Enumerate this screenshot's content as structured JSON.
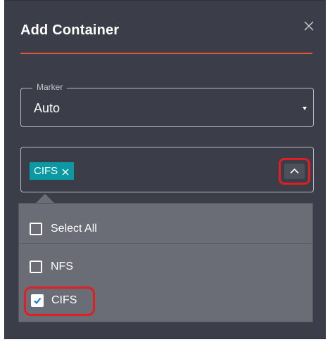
{
  "dialog": {
    "title": "Add Container",
    "close_icon": "close-icon"
  },
  "marker": {
    "legend": "Marker",
    "value": "Auto",
    "caret_icon": "caret-down-icon"
  },
  "type_select": {
    "chips": [
      {
        "label": "CIFS",
        "remove_icon": "close-icon"
      }
    ],
    "toggle_icon": "chevron-up-icon",
    "highlight_color": "#e11f22"
  },
  "dropdown": {
    "select_all": {
      "label": "Select All",
      "checked": false
    },
    "options": [
      {
        "label": "NFS",
        "checked": false
      },
      {
        "label": "CIFS",
        "checked": true
      }
    ]
  },
  "colors": {
    "dialog_bg": "#3b3d48",
    "accent_rule": "#e2583c",
    "chip_bg": "#0b9aa3",
    "dropdown_bg": "#6a6c76"
  }
}
